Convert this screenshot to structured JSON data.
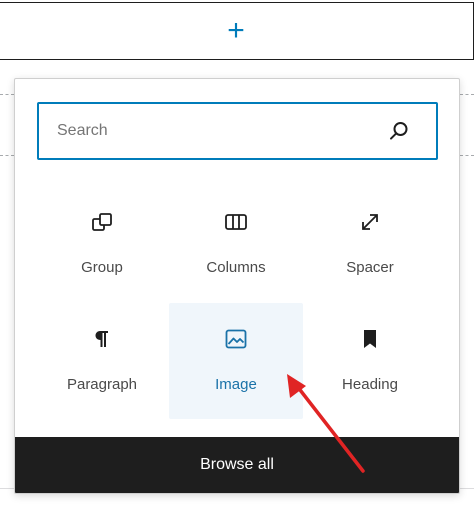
{
  "appender": {
    "symbol": "+",
    "color": "#007cba"
  },
  "inserter": {
    "search": {
      "placeholder": "Search",
      "value": "",
      "icon": "search-icon"
    },
    "blocks": [
      {
        "label": "Group",
        "icon": "group-icon",
        "active": false
      },
      {
        "label": "Columns",
        "icon": "columns-icon",
        "active": false
      },
      {
        "label": "Spacer",
        "icon": "spacer-icon",
        "active": false
      },
      {
        "label": "Paragraph",
        "icon": "paragraph-icon",
        "active": false
      },
      {
        "label": "Image",
        "icon": "image-icon",
        "active": true
      },
      {
        "label": "Heading",
        "icon": "bookmark-icon",
        "active": false
      }
    ],
    "browse_all_label": "Browse all"
  },
  "colors": {
    "accent": "#007cba",
    "active_bg": "#f0f6fb",
    "dark": "#1e1e1e",
    "annotation_arrow": "#e02424"
  }
}
